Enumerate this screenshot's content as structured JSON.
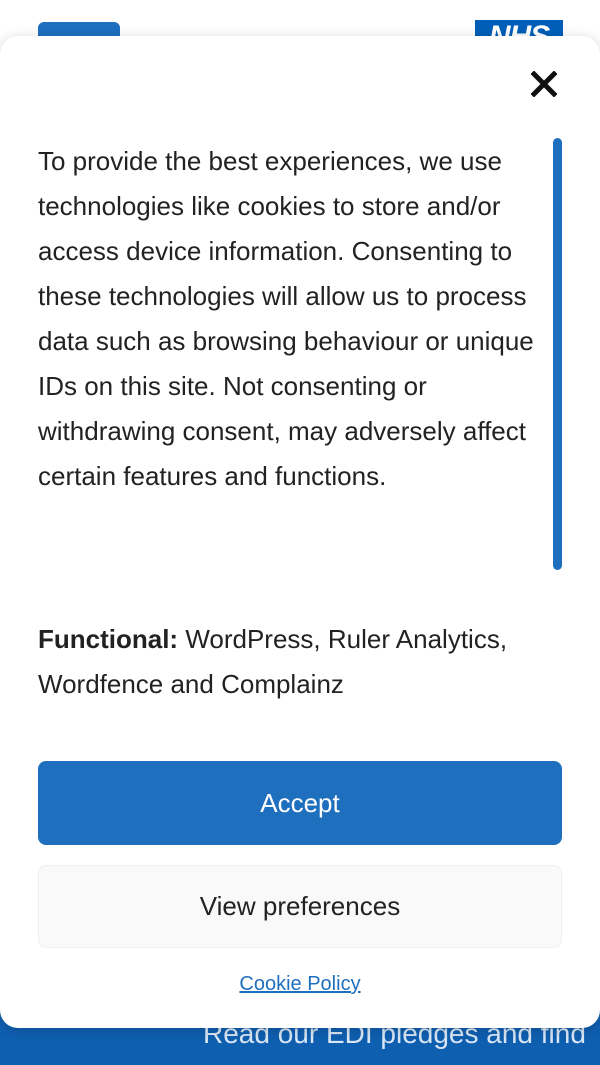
{
  "background": {
    "logo_text": "NHS",
    "footer_text": "Read our EDI pledges and find"
  },
  "consent_modal": {
    "close_label": "×",
    "message": "To provide the best experiences, we use technologies like cookies to store and/or access device information. Consenting to these technologies will allow us to process data such as browsing behaviour or unique IDs on this site. Not consenting or withdrawing consent, may adversely affect certain features and functions.",
    "categories_label": "Functional:",
    "categories_value": " WordPress, Ruler Analytics, Wordfence and Complainz",
    "accept_label": "Accept",
    "preferences_label": "View preferences",
    "cookie_policy_label": "Cookie Policy"
  },
  "colors": {
    "accent": "#1f6fbf",
    "nhs_blue": "#005eb8",
    "text": "#222222",
    "secondary_button_bg": "#f9f9f9"
  },
  "icons": {
    "close": "close-icon"
  }
}
